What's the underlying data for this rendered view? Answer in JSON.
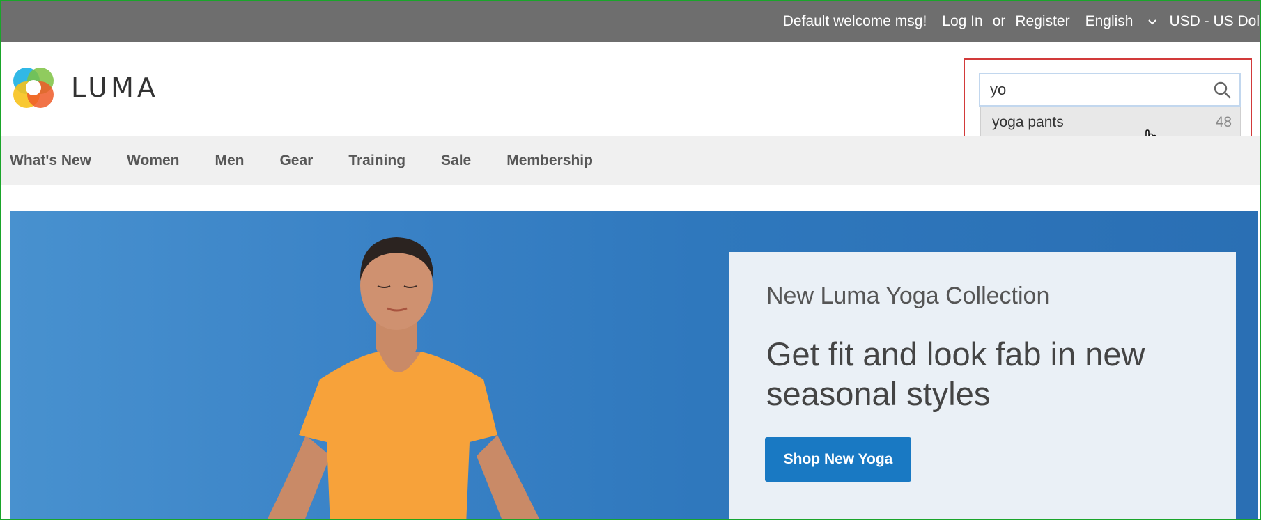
{
  "topbar": {
    "welcome": "Default welcome msg!",
    "login": "Log In",
    "or": "or",
    "register": "Register",
    "language": "English",
    "currency": "USD - US Dol"
  },
  "logo": {
    "text": "LUMA"
  },
  "search": {
    "value": "yo",
    "suggestion": {
      "label": "yoga pants",
      "count": "48"
    }
  },
  "nav": {
    "items": [
      "What's New",
      "Women",
      "Men",
      "Gear",
      "Training",
      "Sale",
      "Membership"
    ]
  },
  "hero": {
    "kicker": "New Luma Yoga Collection",
    "headline": "Get fit and look fab in new seasonal styles",
    "cta": "Shop New Yoga"
  },
  "colors": {
    "topbar": "#6e6e6e",
    "nav": "#f0f0f0",
    "accent": "#1979c3",
    "highlight": "#d23a3a",
    "frame": "#1aa52a"
  },
  "icons": [
    "luma-logo-icon",
    "chevron-down-icon",
    "search-icon",
    "hand-cursor-icon"
  ]
}
